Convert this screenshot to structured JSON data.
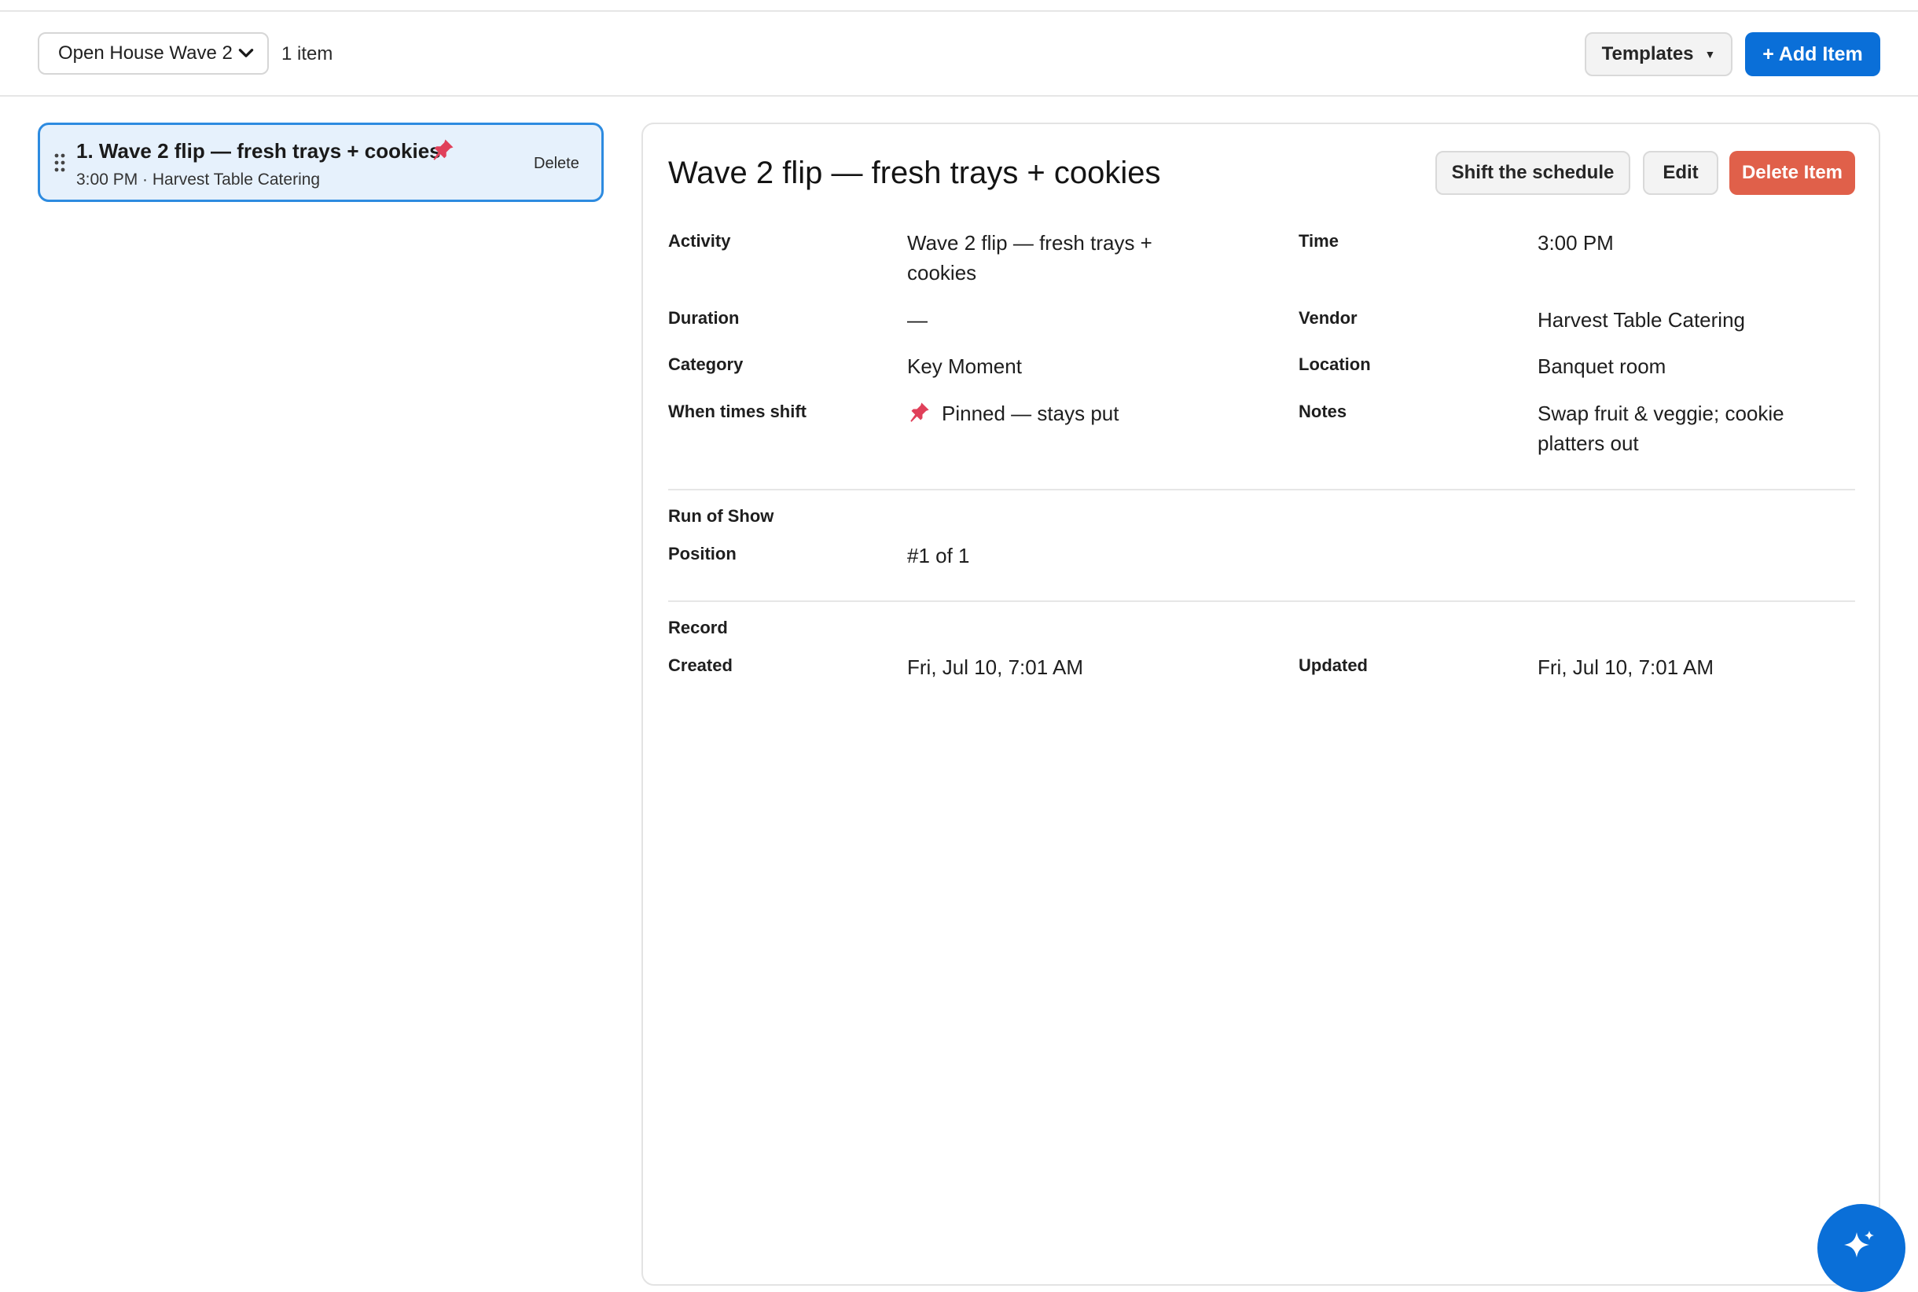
{
  "toolbar": {
    "event_select_value": "Open House Wave 2",
    "item_count": "1 item",
    "templates_label": "Templates",
    "templates_caret": "▼",
    "add_item_label": "+ Add Item"
  },
  "list": {
    "items": [
      {
        "title": "1. Wave 2 flip — fresh trays + cookies",
        "subtitle": "3:00 PM · Harvest Table Catering",
        "delete_label": "Delete",
        "pinned": true
      }
    ]
  },
  "detail": {
    "title": "Wave 2 flip — fresh trays + cookies",
    "shift_label": "Shift the schedule",
    "edit_label": "Edit",
    "delete_label": "Delete Item",
    "fields": {
      "activity_label": "Activity",
      "activity_value": "Wave 2 flip — fresh trays + cookies",
      "time_label": "Time",
      "time_value": "3:00 PM",
      "duration_label": "Duration",
      "duration_value": "—",
      "vendor_label": "Vendor",
      "vendor_value": "Harvest Table Catering",
      "category_label": "Category",
      "category_value": "Key Moment",
      "location_label": "Location",
      "location_value": "Banquet room",
      "shift_label": "When times shift",
      "shift_value": "Pinned — stays put",
      "notes_label": "Notes",
      "notes_value": "Swap fruit & veggie; cookie platters out"
    },
    "run_of_show": {
      "heading": "Run of Show",
      "position_label": "Position",
      "position_value": "#1 of 1"
    },
    "record": {
      "heading": "Record",
      "created_label": "Created",
      "created_value": "Fri, Jul 10, 7:01 AM",
      "updated_label": "Updated",
      "updated_value": "Fri, Jul 10, 7:01 AM"
    }
  },
  "colors": {
    "accent": "#0a6fd8",
    "danger": "#e0604a",
    "selected_bg": "#e6f1fc",
    "selected_border": "#2d8be0",
    "pin": "#e0405a"
  },
  "icons": {
    "select_chevron": "chevron-down-icon",
    "drag": "drag-handle-icon",
    "pin": "pushpin-icon",
    "fab": "sparkle-icon"
  }
}
